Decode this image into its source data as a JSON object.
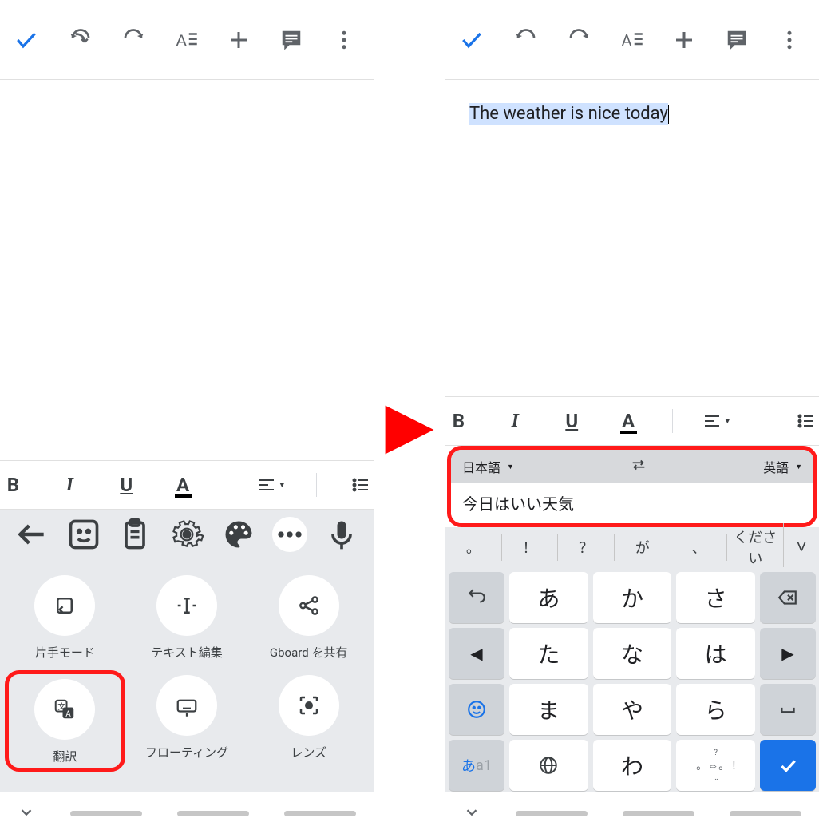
{
  "left": {
    "doc_text": "",
    "fmt": {
      "bold": "B",
      "italic": "I",
      "underline": "U",
      "color": "A"
    },
    "options": [
      {
        "id": "onehand",
        "label": "片手モード",
        "icon": "onehand"
      },
      {
        "id": "textedit",
        "label": "テキスト編集",
        "icon": "textcursor"
      },
      {
        "id": "share",
        "label": "Gboard を共有",
        "icon": "share"
      },
      {
        "id": "translate",
        "label": "翻訳",
        "icon": "translate",
        "highlight": true
      },
      {
        "id": "floating",
        "label": "フローティング",
        "icon": "keyboard"
      },
      {
        "id": "lens",
        "label": "レンズ",
        "icon": "lens"
      }
    ]
  },
  "right": {
    "doc_text": "The weather is nice today",
    "fmt": {
      "bold": "B",
      "italic": "I",
      "underline": "U",
      "color": "A"
    },
    "translate": {
      "from": "日本語",
      "to": "英語",
      "input": "今日はいい天気"
    },
    "suggestions": [
      "。",
      "！",
      "？",
      "が",
      "、",
      "ください"
    ],
    "keys": {
      "row1": {
        "left": "back-arrow",
        "k1": "あ",
        "k2": "か",
        "k3": "さ",
        "right": "backspace"
      },
      "row2": {
        "left": "◀",
        "k1": "た",
        "k2": "な",
        "k3": "は",
        "right": "▶"
      },
      "row3": {
        "left": "emoji",
        "k1": "ま",
        "k2": "や",
        "k3": "ら",
        "right": "space"
      },
      "row4": {
        "left": "あa1",
        "k1": "globe",
        "k2": "わ",
        "hint_top": "?",
        "hint_side": "!",
        "k3": "",
        "right": "enter"
      }
    }
  }
}
